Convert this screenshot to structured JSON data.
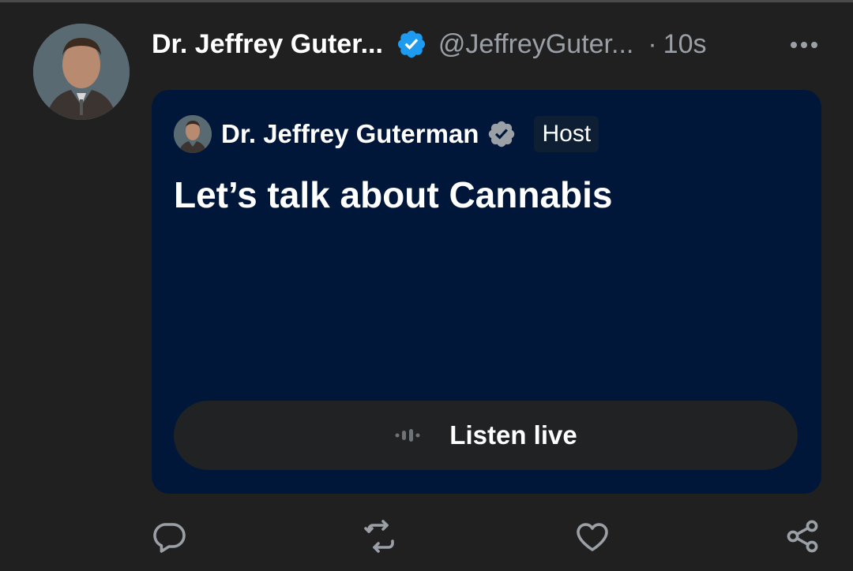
{
  "tweet": {
    "author_name": "Dr. Jeffrey Guter...",
    "handle": "@JeffreyGuter...",
    "separator": "·",
    "time": "10s",
    "more_icon": "more-horizontal-icon",
    "verified_color": "#1d9bf0"
  },
  "space_card": {
    "host_name": "Dr. Jeffrey Guterman",
    "host_badge": "Host",
    "title": "Let’s talk about Cannabis",
    "listen_label": "Listen live",
    "background_color": "#00173a"
  },
  "actions": [
    {
      "name": "reply",
      "icon": "reply-icon"
    },
    {
      "name": "retweet",
      "icon": "retweet-icon"
    },
    {
      "name": "like",
      "icon": "heart-icon"
    },
    {
      "name": "share",
      "icon": "share-icon"
    }
  ]
}
